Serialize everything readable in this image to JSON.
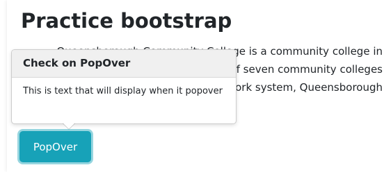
{
  "page": {
    "title": "Practice bootstrap",
    "body_lines": [
      "Queensborough Community College is a community college in",
      "the borough of Queens and one of seven community colleges",
      "of the City University of New York system, Queensborough"
    ]
  },
  "popover": {
    "header": "Check on PopOver",
    "body": "This is text that will display when it popover"
  },
  "button": {
    "label": "PopOver"
  },
  "colors": {
    "accent": "#17a2b8",
    "popover_header_bg": "#f0f0f0"
  }
}
